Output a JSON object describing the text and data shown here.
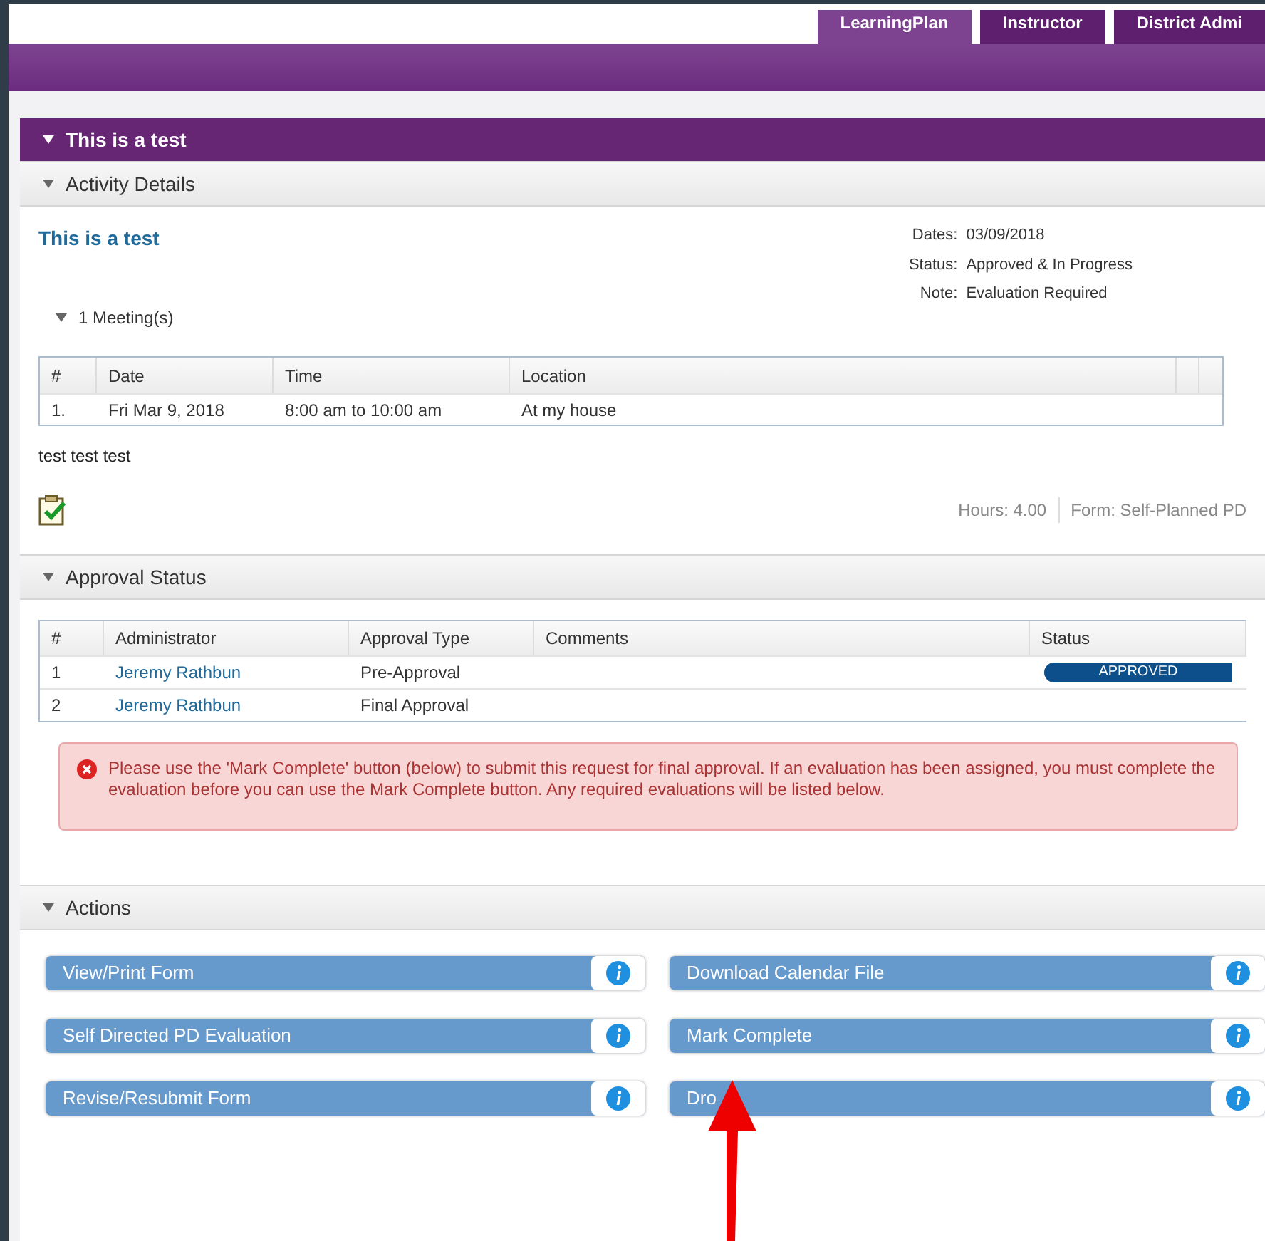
{
  "tabs": [
    {
      "label": "LearningPlan",
      "selected": true
    },
    {
      "label": "Instructor",
      "selected": false
    },
    {
      "label": "District Admi",
      "selected": false
    }
  ],
  "activity": {
    "title": "This is a test",
    "expanded": true
  },
  "details_section": {
    "title": "Activity Details",
    "expanded": true,
    "name": "This is a test",
    "meta": [
      {
        "label": "Dates:",
        "value": "03/09/2018"
      },
      {
        "label": "Status:",
        "value": "Approved & In Progress"
      },
      {
        "label": "Note:",
        "value": "Evaluation Required"
      }
    ],
    "meetings_toggle": {
      "label": "1 Meeting(s)",
      "expanded": true
    },
    "meetings_table": {
      "columns": [
        "#",
        "Date",
        "Time",
        "Location"
      ],
      "rows": [
        [
          "1.",
          "Fri Mar 9, 2018",
          "8:00 am to 10:00 am",
          "At my house"
        ]
      ]
    },
    "description": "test test test",
    "hours": "Hours: 4.00",
    "form": "Form: Self-Planned PD"
  },
  "approval_section": {
    "title": "Approval Status",
    "expanded": true,
    "table": {
      "columns": [
        "#",
        "Administrator",
        "Approval Type",
        "Comments",
        "Status"
      ],
      "rows": [
        {
          "number": "1",
          "administrator": "Jeremy Rathbun",
          "type": "Pre-Approval",
          "comments": "",
          "status": "APPROVED"
        },
        {
          "number": "2",
          "administrator": "Jeremy Rathbun",
          "type": "Final Approval",
          "comments": "",
          "status": ""
        }
      ]
    },
    "alert": "Please use the 'Mark Complete' button (below) to submit this request for final approval. If an evaluation has been assigned, you must complete the evaluation before you can use the Mark Complete button. Any required evaluations will be listed below."
  },
  "actions_section": {
    "title": "Actions",
    "expanded": true,
    "buttons": [
      {
        "label": "View/Print Form"
      },
      {
        "label": "Download Calendar File"
      },
      {
        "label": "Self Directed PD Evaluation"
      },
      {
        "label": "Mark Complete"
      },
      {
        "label": "Revise/Resubmit Form"
      },
      {
        "label": "Dro"
      }
    ]
  }
}
